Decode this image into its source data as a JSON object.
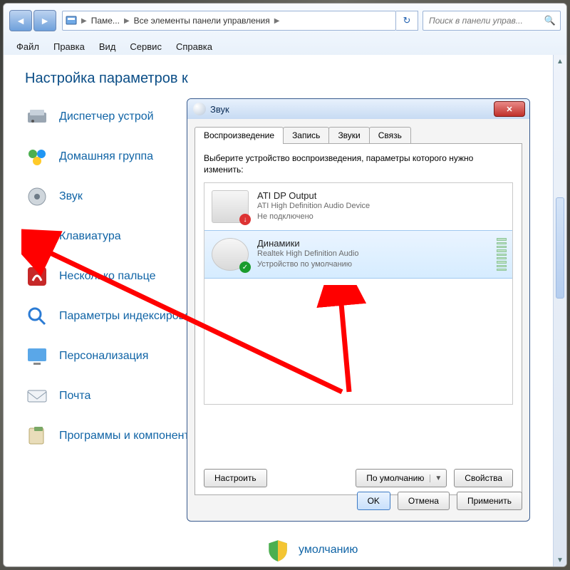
{
  "window": {
    "breadcrumbs": [
      "Паме...",
      "Все элементы панели управления"
    ],
    "search_placeholder": "Поиск в панели управ...",
    "menubar": [
      "Файл",
      "Правка",
      "Вид",
      "Сервис",
      "Справка"
    ],
    "heading": "Настройка параметров к",
    "cp_items": [
      "Диспетчер устрой",
      "Домашняя группа",
      "Звук",
      "Клавиатура",
      "Несколько пальце",
      "Параметры индексирования",
      "Персонализация",
      "Почта",
      "Программы и компоненты"
    ],
    "right_item_line1": "умолчанию"
  },
  "dialog": {
    "title": "Звук",
    "tabs": [
      "Воспроизведение",
      "Запись",
      "Звуки",
      "Связь"
    ],
    "active_tab": 0,
    "prompt": "Выберите устройство воспроизведения, параметры которого нужно изменить:",
    "devices": [
      {
        "name": "ATI DP Output",
        "sub1": "ATI High Definition Audio Device",
        "sub2": "Не подключено",
        "status": "error",
        "selected": false
      },
      {
        "name": "Динамики",
        "sub1": "Realtek High Definition Audio",
        "sub2": "Устройство по умолчанию",
        "status": "ok",
        "selected": true
      }
    ],
    "btn_configure": "Настроить",
    "btn_default": "По умолчанию",
    "btn_properties": "Свойства",
    "btn_ok": "OK",
    "btn_cancel": "Отмена",
    "btn_apply": "Применить"
  }
}
